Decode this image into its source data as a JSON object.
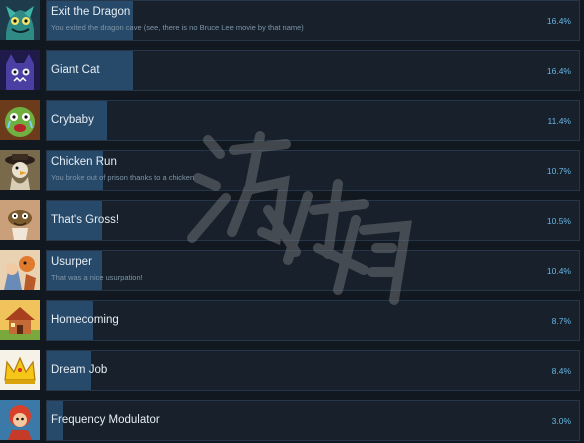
{
  "achievements": [
    {
      "title": "Exit the Dragon",
      "description": "You exited the dragon cave (see, there is no Bruce Lee movie by that name)",
      "percent_label": "16.4%",
      "percent": 16.4,
      "icon": "dragon-icon"
    },
    {
      "title": "Giant Cat",
      "description": "",
      "percent_label": "16.4%",
      "percent": 16.4,
      "icon": "giant-cat-icon"
    },
    {
      "title": "Crybaby",
      "description": "",
      "percent_label": "11.4%",
      "percent": 11.4,
      "icon": "crybaby-icon"
    },
    {
      "title": "Chicken Run",
      "description": "You broke out of prison thanks to a chicken",
      "percent_label": "10.7%",
      "percent": 10.7,
      "icon": "chicken-icon"
    },
    {
      "title": "That's Gross!",
      "description": "",
      "percent_label": "10.5%",
      "percent": 10.5,
      "icon": "gross-creature-icon"
    },
    {
      "title": "Usurper",
      "description": "That was a nice usurpation!",
      "percent_label": "10.4%",
      "percent": 10.4,
      "icon": "usurper-icon"
    },
    {
      "title": "Homecoming",
      "description": "",
      "percent_label": "8.7%",
      "percent": 8.7,
      "icon": "house-icon"
    },
    {
      "title": "Dream Job",
      "description": "",
      "percent_label": "8.4%",
      "percent": 8.4,
      "icon": "crown-icon"
    },
    {
      "title": "Frequency Modulator",
      "description": "",
      "percent_label": "3.0%",
      "percent": 3.0,
      "icon": "radio-character-icon"
    }
  ],
  "colors": {
    "background": "#111820",
    "panel": "#17202b",
    "progress_fill": "#274a6a",
    "percent_text": "#67b7e6"
  }
}
